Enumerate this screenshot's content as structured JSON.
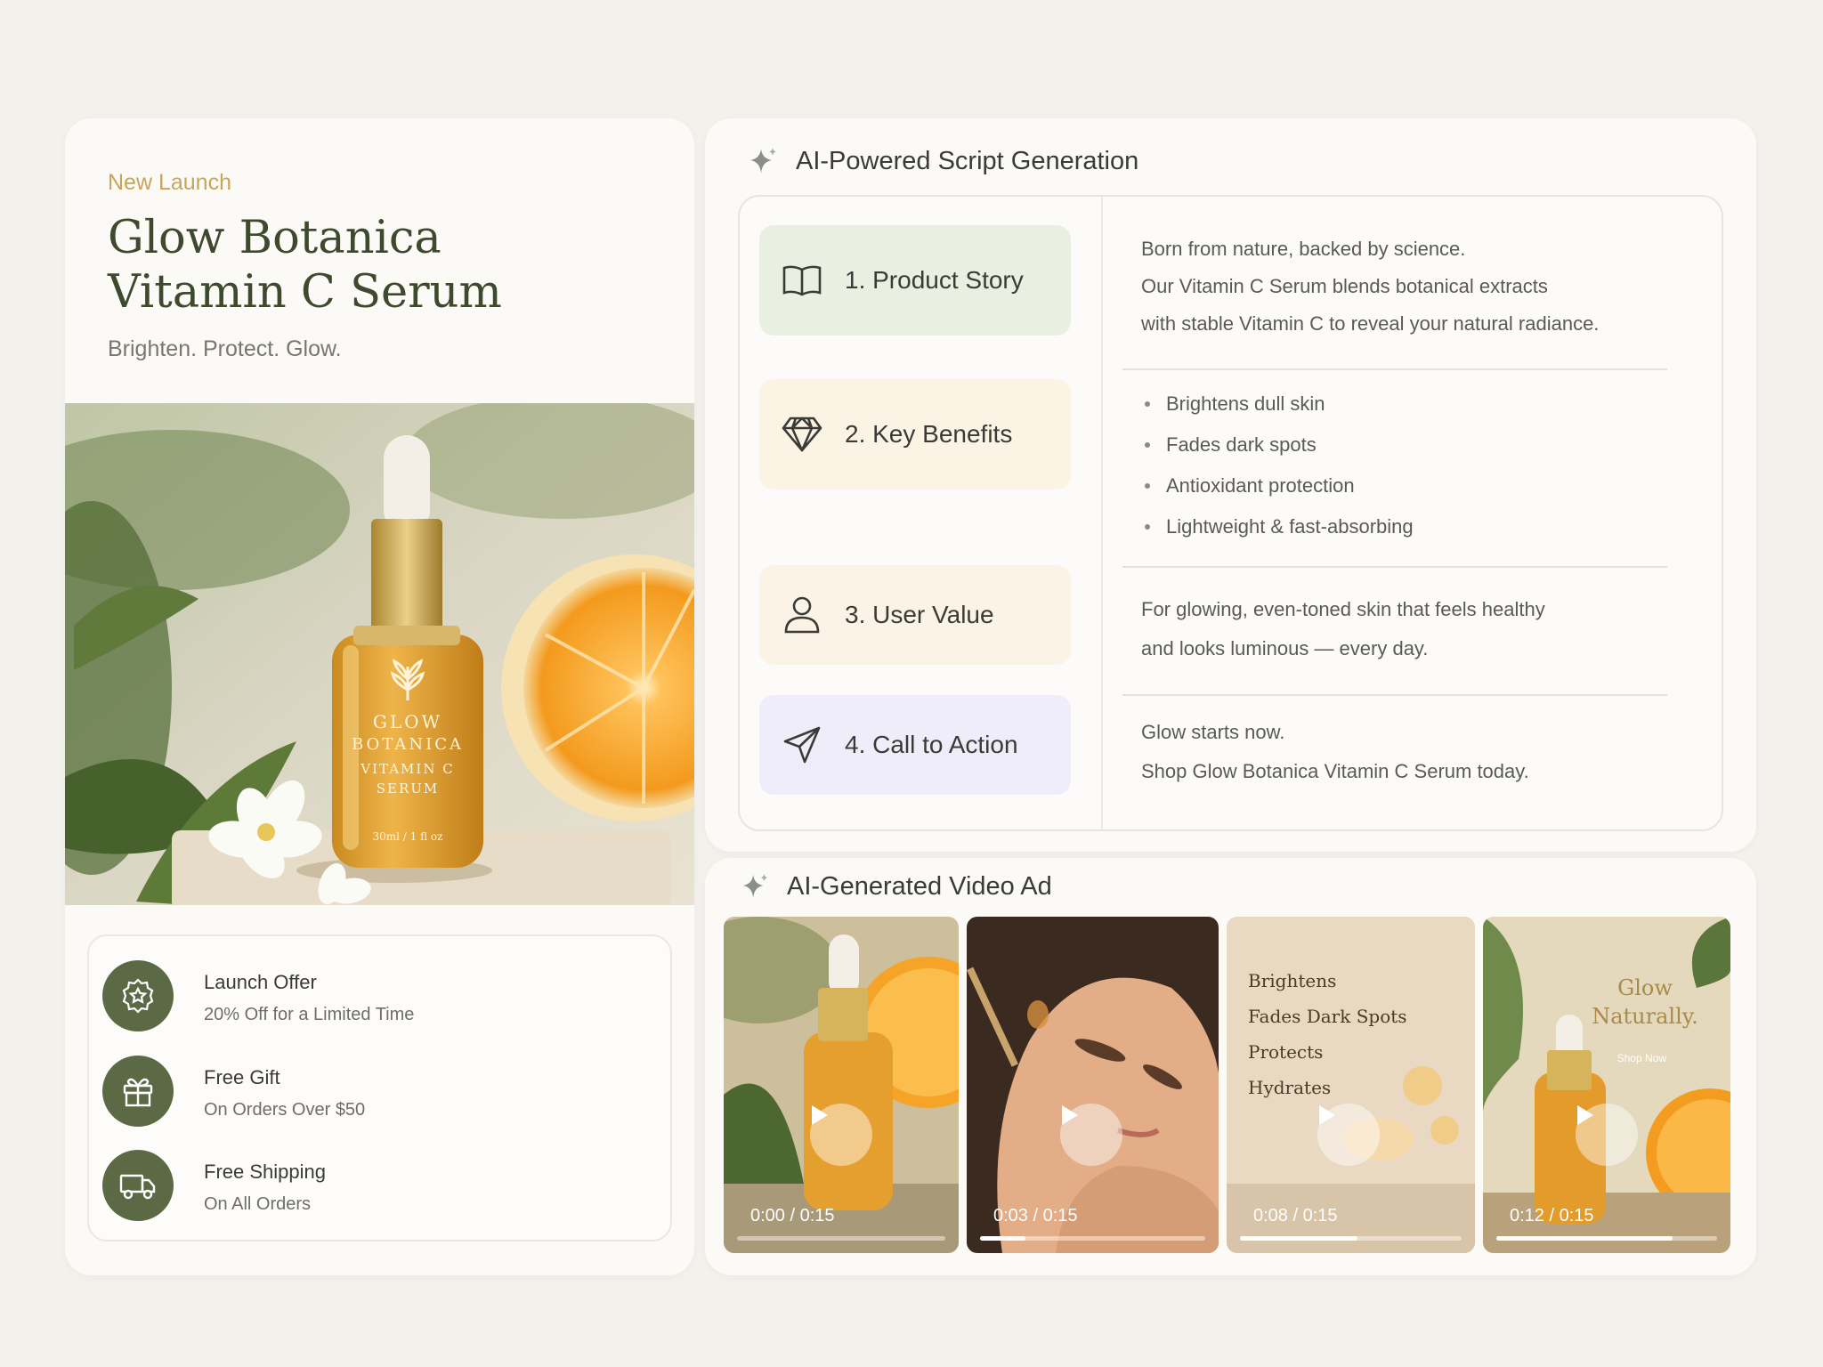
{
  "product": {
    "eyebrow": "New Launch",
    "title_line1": "Glow Botanica",
    "title_line2": "Vitamin C Serum",
    "tagline": "Brighten. Protect. Glow.",
    "bottle_label": [
      "GLOW",
      "BOTANICA",
      "VITAMIN C",
      "SERUM"
    ],
    "bottle_volume": "30ml / 1 fl oz"
  },
  "offers": [
    {
      "icon": "badge-star-icon",
      "title": "Launch Offer",
      "subtitle": "20% Off for a Limited Time"
    },
    {
      "icon": "gift-icon",
      "title": "Free Gift",
      "subtitle": "On Orders Over $50"
    },
    {
      "icon": "truck-icon",
      "title": "Free Shipping",
      "subtitle": "On All Orders"
    }
  ],
  "script": {
    "title": "AI-Powered Script Generation",
    "steps": [
      {
        "icon": "book-icon",
        "label": "1. Product Story",
        "color": "#e9f0e2"
      },
      {
        "icon": "diamond-icon",
        "label": "2. Key Benefits",
        "color": "#fbf4e4"
      },
      {
        "icon": "user-icon",
        "label": "3. User Value",
        "color": "#fbf3e5"
      },
      {
        "icon": "send-icon",
        "label": "4. Call to Action",
        "color": "#eeedf9"
      }
    ],
    "story": [
      "Born from nature, backed by science.",
      "Our Vitamin C Serum blends botanical extracts",
      "with stable Vitamin C to reveal your natural radiance."
    ],
    "benefits": [
      "Brightens dull skin",
      "Fades dark spots",
      "Antioxidant protection",
      "Lightweight & fast-absorbing"
    ],
    "user_value": [
      "For glowing, even-toned skin that feels healthy",
      "and looks luminous — every day."
    ],
    "cta": [
      "Glow starts now.",
      "Shop Glow Botanica Vitamin C Serum today."
    ]
  },
  "video": {
    "title": "AI-Generated Video Ad",
    "clips": [
      {
        "time": "0:00 / 0:15",
        "progress": 0.0
      },
      {
        "time": "0:03 / 0:15",
        "progress": 0.2
      },
      {
        "time": "0:08 / 0:15",
        "progress": 0.53,
        "overlay": [
          "Brightens",
          "Fades Dark Spots",
          "Protects",
          "Hydrates"
        ]
      },
      {
        "time": "0:12 / 0:15",
        "progress": 0.8,
        "overlay_title": "Glow Naturally.",
        "overlay_sub": "Shop Now"
      }
    ]
  },
  "colors": {
    "accent_gold": "#c9a55a",
    "accent_green": "#5b6a45",
    "title_green": "#3e4a2e"
  }
}
